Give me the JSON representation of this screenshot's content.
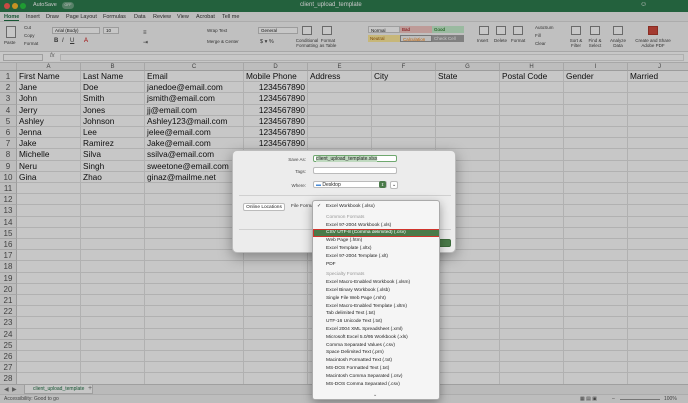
{
  "window": {
    "autosave": "AutoSave",
    "autosave_state": "OFF",
    "doc_title": "client_upload_template"
  },
  "menu": [
    "Home",
    "Insert",
    "Draw",
    "Page Layout",
    "Formulas",
    "Data",
    "Review",
    "View",
    "Acrobat",
    "Tell me"
  ],
  "ribbon": {
    "paste": "Paste",
    "cut": "Cut",
    "copy": "Copy",
    "format": "Format",
    "font": "Arial (Body)",
    "font_size": "10",
    "wrap_text": "Wrap Text",
    "merge": "Merge & Center",
    "number_format": "General",
    "cond_format": "Conditional Formatting",
    "format_table": "Format as Table",
    "styles": {
      "normal": "Normal",
      "bad": "Bad",
      "good": "Good",
      "neutral": "Neutral",
      "calculation": "Calculation",
      "check_cell": "Check Cell"
    },
    "insert": "Insert",
    "delete": "Delete",
    "format_cells": "Format",
    "autosum": "AutoSum",
    "fill": "Fill",
    "clear": "Clear",
    "sort_filter": "Sort & Filter",
    "find_select": "Find & Select",
    "analyze": "Analyze Data",
    "adobe": "Create and Share Adobe PDF"
  },
  "columns": [
    "A",
    "B",
    "C",
    "D",
    "E",
    "F",
    "G",
    "H",
    "I",
    "J"
  ],
  "rows": [
    [
      "First Name",
      "Last Name",
      "Email",
      "Mobile Phone",
      "Address",
      "City",
      "State",
      "Postal Code",
      "Gender",
      "Married"
    ],
    [
      "Jane",
      "Doe",
      "janedoe@email.com",
      "1234567890",
      "",
      "",
      "",
      "",
      "",
      ""
    ],
    [
      "John",
      "Smith",
      "jsmith@email.com",
      "1234567890",
      "",
      "",
      "",
      "",
      "",
      ""
    ],
    [
      "Jerry",
      "Jones",
      "jj@email.com",
      "1234567890",
      "",
      "",
      "",
      "",
      "",
      ""
    ],
    [
      "Ashley",
      "Johnson",
      "Ashley123@mail.com",
      "1234567890",
      "",
      "",
      "",
      "",
      "",
      ""
    ],
    [
      "Jenna",
      "Lee",
      "jelee@email.com",
      "1234567890",
      "",
      "",
      "",
      "",
      "",
      ""
    ],
    [
      "Jake",
      "Ramirez",
      "Jake@email.com",
      "1234567890",
      "",
      "",
      "",
      "",
      "",
      ""
    ],
    [
      "Michelle",
      "Silva",
      "ssilva@email.com",
      "1234567890",
      "",
      "",
      "",
      "",
      "",
      ""
    ],
    [
      "Neru",
      "Singh",
      "sweetone@email.com",
      "1234567890",
      "",
      "",
      "",
      "",
      "",
      ""
    ],
    [
      "Gina",
      "Zhao",
      "ginaz@mailme.net",
      "1234567890",
      "",
      "",
      "",
      "",
      "",
      ""
    ],
    [
      "",
      "",
      "",
      "",
      "",
      "",
      "",
      "",
      "",
      ""
    ],
    [
      "",
      "",
      "",
      "",
      "",
      "",
      "",
      "",
      "",
      ""
    ],
    [
      "",
      "",
      "",
      "",
      "",
      "",
      "",
      "",
      "",
      ""
    ],
    [
      "",
      "",
      "",
      "",
      "",
      "",
      "",
      "",
      "",
      ""
    ],
    [
      "",
      "",
      "",
      "",
      "",
      "",
      "",
      "",
      "",
      ""
    ],
    [
      "",
      "",
      "",
      "",
      "",
      "",
      "",
      "",
      "",
      ""
    ],
    [
      "",
      "",
      "",
      "",
      "",
      "",
      "",
      "",
      "",
      ""
    ],
    [
      "",
      "",
      "",
      "",
      "",
      "",
      "",
      "",
      "",
      ""
    ],
    [
      "",
      "",
      "",
      "",
      "",
      "",
      "",
      "",
      "",
      ""
    ],
    [
      "",
      "",
      "",
      "",
      "",
      "",
      "",
      "",
      "",
      ""
    ],
    [
      "",
      "",
      "",
      "",
      "",
      "",
      "",
      "",
      "",
      ""
    ],
    [
      "",
      "",
      "",
      "",
      "",
      "",
      "",
      "",
      "",
      ""
    ],
    [
      "",
      "",
      "",
      "",
      "",
      "",
      "",
      "",
      "",
      ""
    ],
    [
      "",
      "",
      "",
      "",
      "",
      "",
      "",
      "",
      "",
      ""
    ],
    [
      "",
      "",
      "",
      "",
      "",
      "",
      "",
      "",
      "",
      ""
    ],
    [
      "",
      "",
      "",
      "",
      "",
      "",
      "",
      "",
      "",
      ""
    ],
    [
      "",
      "",
      "",
      "",
      "",
      "",
      "",
      "",
      "",
      ""
    ],
    [
      "",
      "",
      "",
      "",
      "",
      "",
      "",
      "",
      "",
      ""
    ]
  ],
  "sheet_tab": "client_upload_template",
  "status": "Accessibility: Good to go",
  "zoom": "100%",
  "dialog": {
    "save_as_label": "Save As:",
    "save_as_value": "client_upload_template.xlsx",
    "tags_label": "Tags:",
    "where_label": "Where:",
    "where_value": "Desktop",
    "online_locations": "Online Locations",
    "file_format_label": "File Format"
  },
  "dropdown": {
    "selected": "Excel Workbook (.xlsx)",
    "common_header": "Common Formats",
    "common": [
      "Excel 97-2004 Workbook (.xls)",
      "CSV UTF-8 (Comma delimited) (.csv)",
      "Web Page (.htm)",
      "Excel Template (.xltx)",
      "Excel 97-2004 Template (.xlt)",
      "PDF"
    ],
    "highlighted_index": 1,
    "specialty_header": "Specialty Formats",
    "specialty": [
      "Excel Macro-Enabled Workbook (.xlsm)",
      "Excel Binary Workbook (.xlsb)",
      "Single File Web Page (.mht)",
      "Excel Macro-Enabled Template (.xltm)",
      "Tab delimited Text (.txt)",
      "UTF-16 Unicode Text (.txt)",
      "Excel 2004 XML Spreadsheet (.xml)",
      "Microsoft Excel 5.0/95 Workbook (.xls)",
      "Comma Separated Values (.csv)",
      "Space Delimited Text (.prn)",
      "Macintosh Formatted Text (.txt)",
      "MS-DOS Formatted Text (.txt)",
      "Macintosh Comma Separated (.csv)",
      "MS-DOS Comma Separated (.csv)"
    ]
  },
  "colors": {
    "excel_green": "#2e7d4f",
    "highlight": "#4a7a49",
    "highlight_border": "#d0342c"
  }
}
